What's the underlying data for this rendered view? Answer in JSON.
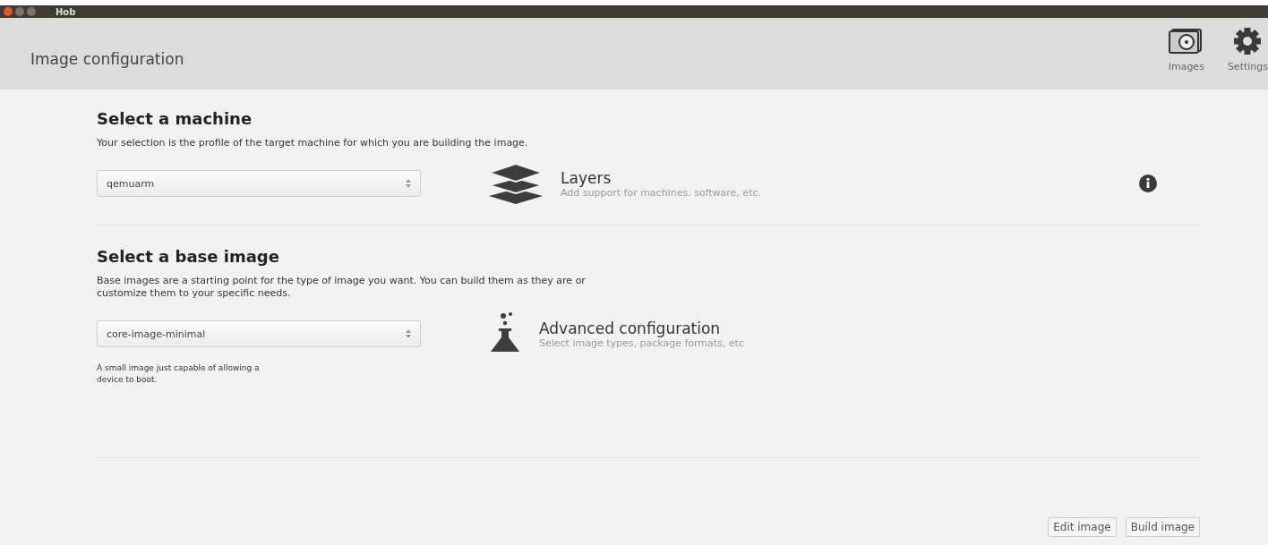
{
  "window": {
    "title": "Hob"
  },
  "header": {
    "title": "Image configuration",
    "tools": [
      {
        "kind": "images",
        "label": "Images"
      },
      {
        "kind": "settings",
        "label": "Settings"
      }
    ]
  },
  "machine": {
    "heading": "Select a machine",
    "description": "Your selection is the profile of the target machine for which you are building the image.",
    "value": "qemuarm"
  },
  "layers": {
    "title": "Layers",
    "subtitle": "Add support for machines, software, etc."
  },
  "base_image": {
    "heading": "Select a base image",
    "description": "Base images are a starting point for the type of image you want. You can build them as they are or customize them to your specific needs.",
    "value": "core-image-minimal",
    "note": "A small image just capable of allowing a device to boot."
  },
  "advanced": {
    "title": "Advanced configuration",
    "subtitle": "Select image types, package formats, etc"
  },
  "buttons": [
    "Edit image",
    "Build image"
  ]
}
